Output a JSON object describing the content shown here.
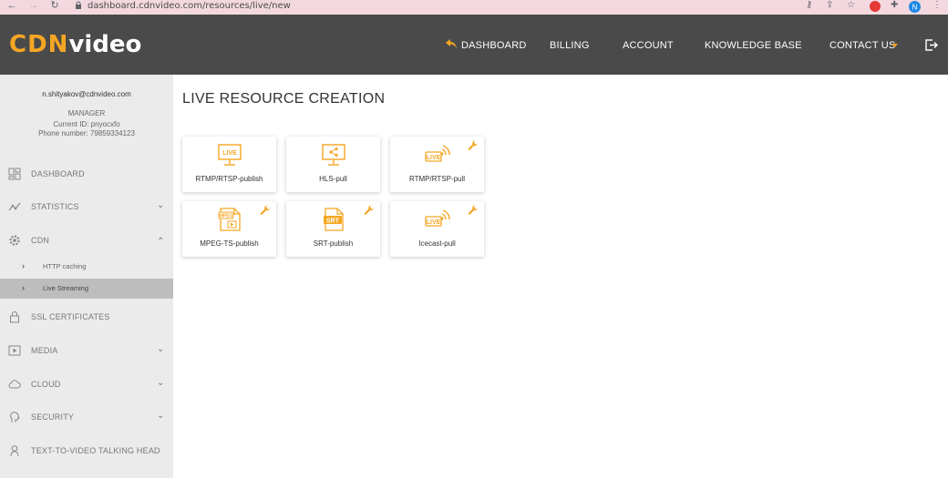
{
  "browser": {
    "url": "dashboard.cdnvideo.com/resources/live/new",
    "profile_initial": "N"
  },
  "header": {
    "logo_cdn": "CDN",
    "logo_video": "video",
    "menu": [
      {
        "label": "DASHBOARD"
      },
      {
        "label": "BILLING"
      },
      {
        "label": "ACCOUNT"
      },
      {
        "label": "KNOWLEDGE BASE"
      },
      {
        "label": "CONTACT US"
      }
    ]
  },
  "sidebar": {
    "user": {
      "email": "n.shityakov@cdnvideo.com",
      "role": "MANAGER",
      "current_id": "Current ID: pnyocxfo",
      "phone": "Phone number: 79859334123"
    },
    "items": [
      {
        "label": "DASHBOARD",
        "icon": "dashboard-icon"
      },
      {
        "label": "STATISTICS",
        "icon": "statistics-icon"
      },
      {
        "label": "CDN",
        "icon": "gear-icon"
      },
      {
        "label": "HTTP caching"
      },
      {
        "label": "Live Streaming"
      },
      {
        "label": "SSL CERTIFICATES",
        "icon": "lock-icon"
      },
      {
        "label": "MEDIA",
        "icon": "media-icon"
      },
      {
        "label": "CLOUD",
        "icon": "cloud-icon"
      },
      {
        "label": "SECURITY",
        "icon": "security-icon"
      },
      {
        "label": "TEXT-TO-VIDEO TALKING HEAD",
        "icon": "talking-head-icon"
      }
    ]
  },
  "main": {
    "title": "LIVE RESOURCE CREATION",
    "cards": [
      {
        "label": "RTMP/RTSP-publish",
        "icon": "live-monitor-icon",
        "badge": "LIVE"
      },
      {
        "label": "HLS-pull",
        "icon": "share-monitor-icon"
      },
      {
        "label": "RTMP/RTSP-pull",
        "icon": "live-broadcast-icon",
        "badge": "LIVE"
      },
      {
        "label": "MPEG-TS-publish",
        "icon": "mpeg-file-icon",
        "badge": "MPEG"
      },
      {
        "label": "SRT-publish",
        "icon": "srt-file-icon",
        "badge": "SRT"
      },
      {
        "label": "Icecast-pull",
        "icon": "live-broadcast-icon",
        "badge": "LIVE"
      }
    ]
  },
  "colors": {
    "accent": "#f5a623",
    "header_bg": "#4a4a4a",
    "sidebar_bg": "#ebebeb",
    "active_bg": "#bdbdbd"
  }
}
